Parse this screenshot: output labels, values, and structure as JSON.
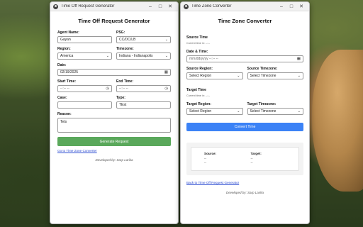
{
  "window1": {
    "title": "Time Off Request Generator",
    "heading": "Time Off Request Generator",
    "agent_name_label": "Agent Name:",
    "agent_name_value": "Gayan",
    "psg_label": "PSG:",
    "psg_value": "CC/DC/LB",
    "region_label": "Region:",
    "region_value": "America",
    "timezone_label": "Timezone:",
    "timezone_value": "Indiana - Indianapolis",
    "date_label": "Date:",
    "date_value": "02/19/2025",
    "start_time_label": "Start Time:",
    "start_time_value": "--:-- --",
    "end_time_label": "End Time:",
    "end_time_value": "--:-- --",
    "case_label": "Case:",
    "case_value": "",
    "type_label": "Type:",
    "type_value": "TEst",
    "reason_label": "Reason:",
    "reason_value": "Tets",
    "generate_button": "Generate Request",
    "tz_link": "Go to Time Zone Converter",
    "footer": "Developed by: Sarp Larika"
  },
  "window2": {
    "title": "Time Zone Converter",
    "heading": "Time Zone Converter",
    "source_time_label": "Source Time",
    "source_current_hint": "Current time in: --:--",
    "date_time_label": "Date & Time:",
    "date_time_value": "mm/dd/yyyy --:-- --",
    "source_region_label": "Source Region:",
    "source_region_value": "Select Region",
    "source_timezone_label": "Source Timezone:",
    "source_timezone_value": "Select Timezone",
    "target_time_label": "Target Time",
    "target_current_hint": "Current time in: --:--",
    "target_region_label": "Target Region:",
    "target_region_value": "Select Region",
    "target_timezone_label": "Target Timezone:",
    "target_timezone_value": "Select Timezone",
    "convert_button": "Convert Time",
    "result_source_label": "Source:",
    "result_source_val1": "--",
    "result_source_val2": "--",
    "result_target_label": "Target:",
    "result_target_val1": "--",
    "result_target_val2": "--",
    "back_link": "Back to Time Off Request Generator",
    "footer": "Developed by: Sarp Larika"
  },
  "window_controls": {
    "minimize": "–",
    "maximize": "□",
    "close": "✕"
  },
  "icons": {
    "chevron": "chevron-down-icon",
    "calendar": "calendar-icon",
    "clock": "clock-icon"
  },
  "colors": {
    "generate_button": "#5aa85b",
    "convert_button": "#3b82f6",
    "link": "#2b4bd1"
  }
}
